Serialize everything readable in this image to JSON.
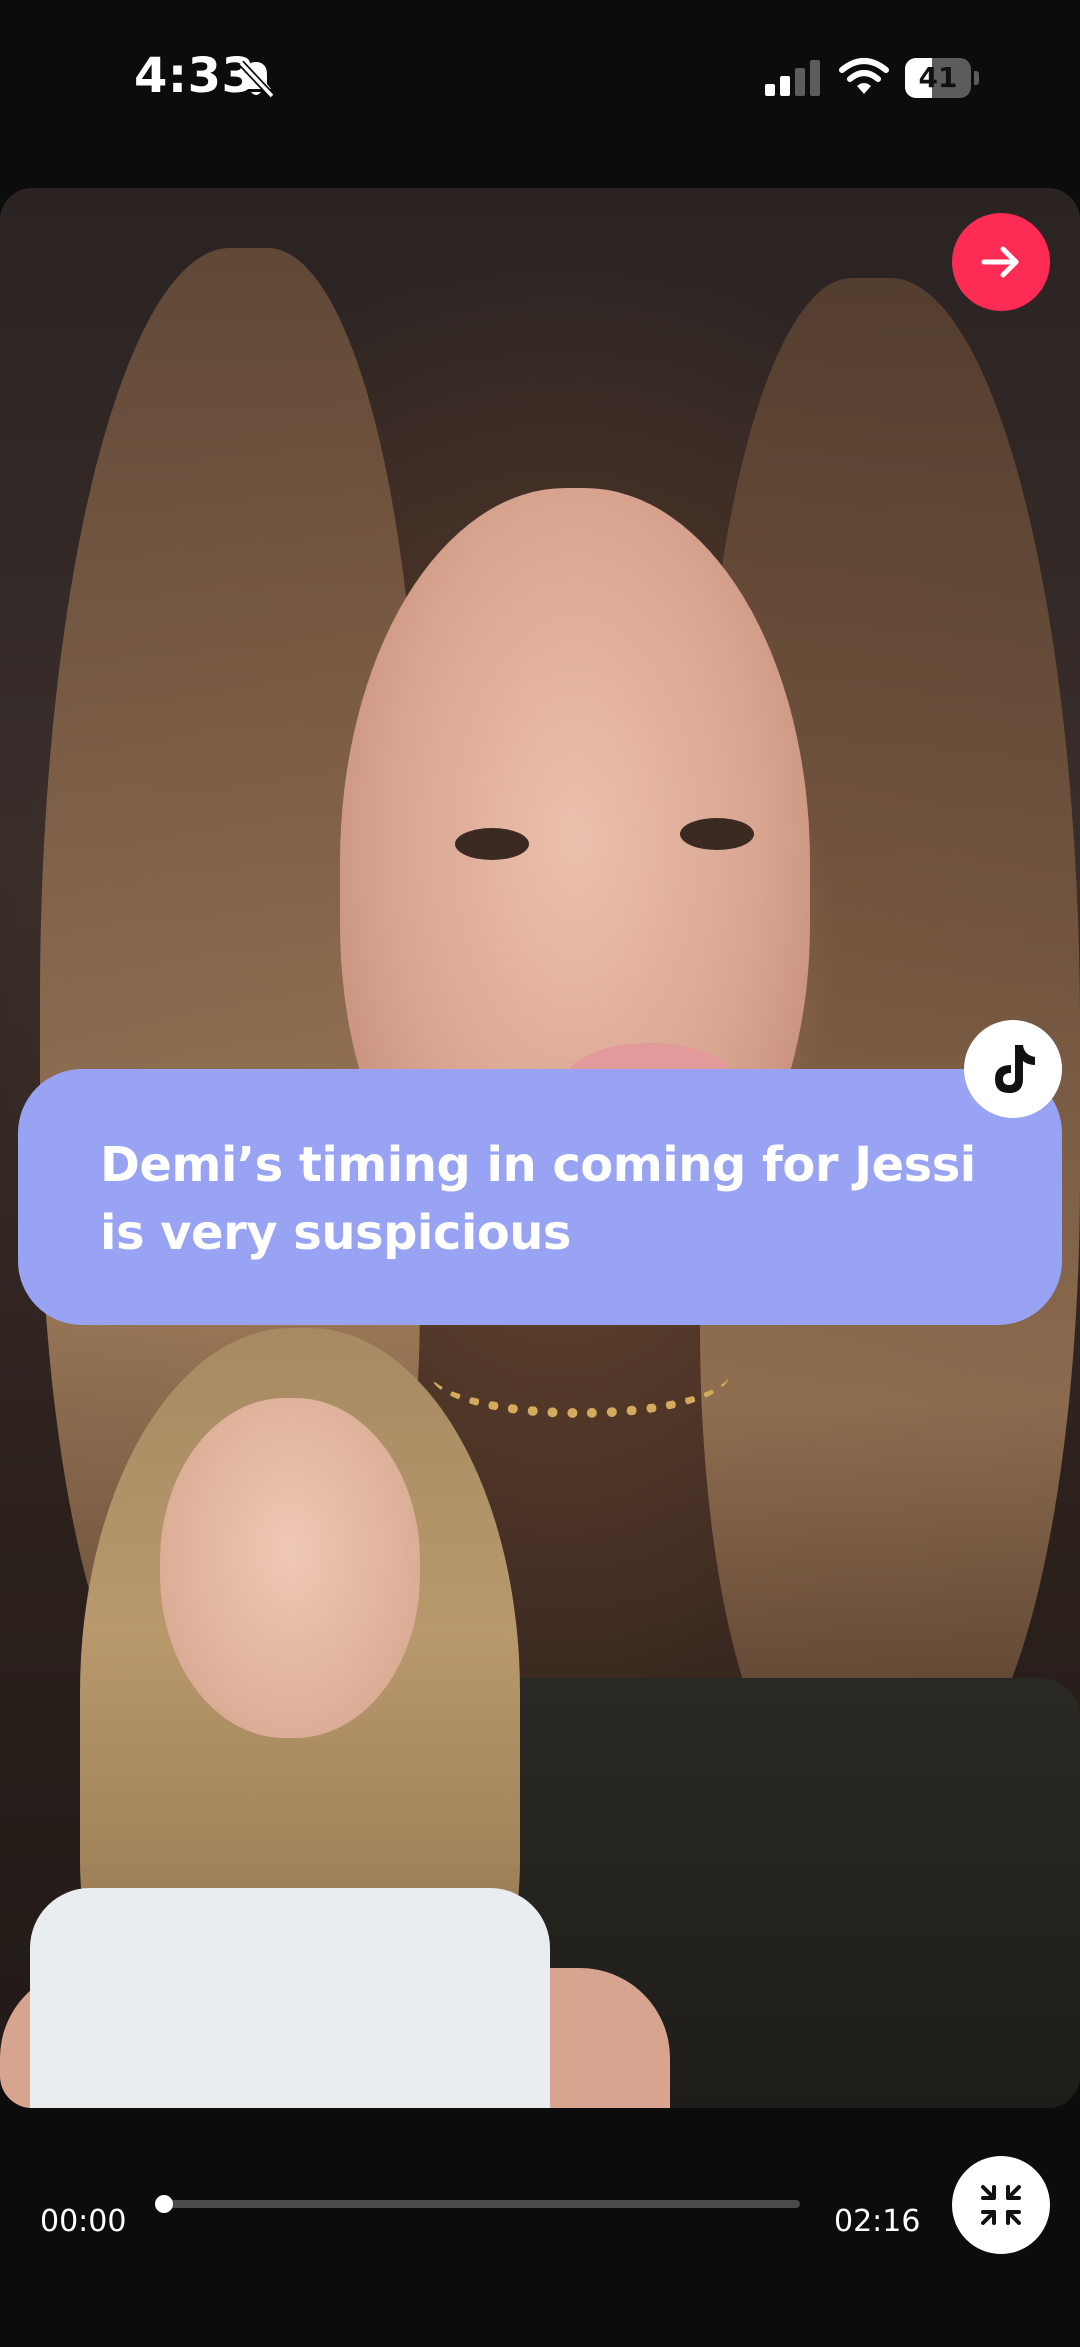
{
  "status_bar": {
    "time": "4:33",
    "battery_level": "41",
    "battery_fraction": 0.41,
    "icons": [
      "bell-slash-icon",
      "cellular-signal-icon",
      "wifi-icon",
      "battery-icon"
    ]
  },
  "video": {
    "caption": "Demi’s timing in coming for Jessi is very suspicious",
    "caption_background": "#98a4f3",
    "next_button_icon": "arrow-right-icon",
    "next_button_color": "#fe2c55",
    "badge_icon": "tiktok-logo-icon"
  },
  "player": {
    "current_time": "00:00",
    "total_time": "02:16",
    "progress_fraction": 0.0,
    "collapse_icon": "collapse-arrows-icon"
  }
}
